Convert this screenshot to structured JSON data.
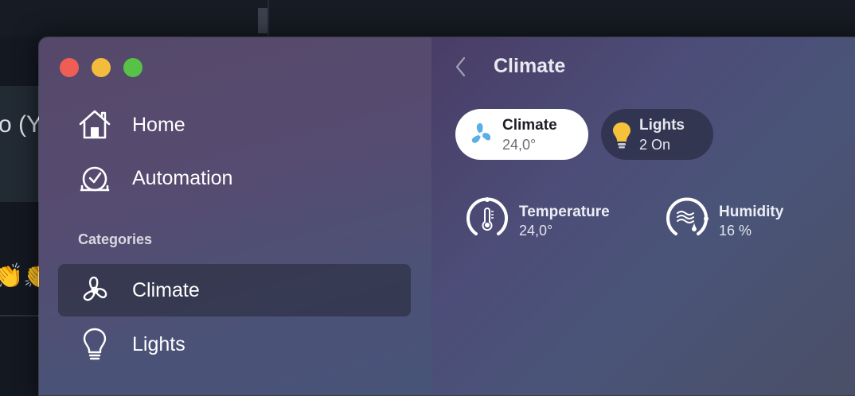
{
  "background": {
    "partial_title": "o (Yo"
  },
  "window": {
    "traffic_lights": [
      "close",
      "minimize",
      "zoom"
    ]
  },
  "sidebar": {
    "items": [
      {
        "label": "Home",
        "icon": "home-icon"
      },
      {
        "label": "Automation",
        "icon": "automation-clock-icon"
      }
    ],
    "section_title": "Categories",
    "categories": [
      {
        "label": "Climate",
        "icon": "fan-icon",
        "selected": true
      },
      {
        "label": "Lights",
        "icon": "lightbulb-icon",
        "selected": false
      }
    ]
  },
  "content": {
    "title": "Climate",
    "tiles": [
      {
        "title": "Climate",
        "subtitle": "24,0°",
        "icon": "fan-icon",
        "style": "white"
      },
      {
        "title": "Lights",
        "subtitle": "2 On",
        "icon": "lightbulb-icon",
        "style": "dark"
      }
    ],
    "sensors": [
      {
        "title": "Temperature",
        "value": "24,0°",
        "icon": "thermometer-gauge-icon"
      },
      {
        "title": "Humidity",
        "value": "16 %",
        "icon": "humidity-gauge-icon"
      }
    ]
  },
  "colors": {
    "accent_fan": "#5aaee6",
    "bulb_yellow": "#f6c23b",
    "traffic_red": "#ee5e55",
    "traffic_yellow": "#f4bc3d",
    "traffic_green": "#58c148"
  }
}
